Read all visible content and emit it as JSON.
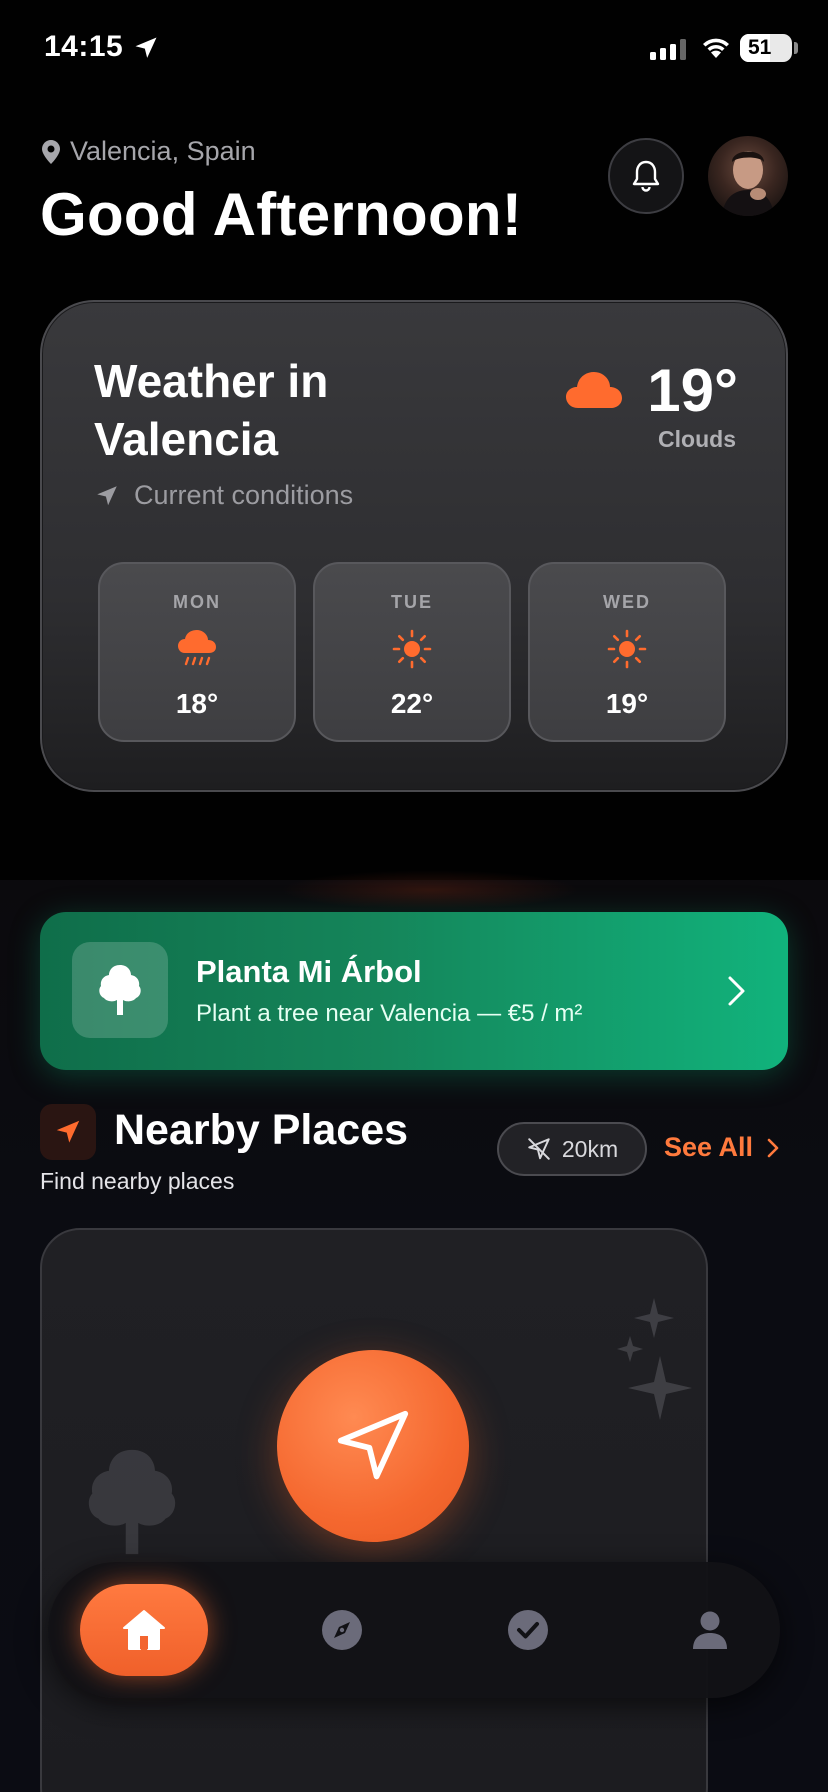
{
  "status_bar": {
    "time": "14:15",
    "battery": "51"
  },
  "header": {
    "location": "Valencia, Spain",
    "greeting": "Good Afternoon!"
  },
  "weather": {
    "title": "Weather in Valencia",
    "subtitle": "Current conditions",
    "temperature": "19°",
    "condition": "Clouds",
    "forecast": [
      {
        "day": "MON",
        "icon": "rain-cloud-icon",
        "temp": "18°"
      },
      {
        "day": "TUE",
        "icon": "sun-icon",
        "temp": "22°"
      },
      {
        "day": "WED",
        "icon": "sun-icon",
        "temp": "19°"
      }
    ]
  },
  "promo": {
    "title": "Planta Mi Árbol",
    "subtitle": "Plant a tree near Valencia — €5 / m²"
  },
  "nearby": {
    "title": "Nearby Places",
    "subtitle": "Find nearby places",
    "radius": "20km",
    "see_all": "See All"
  },
  "tabbar": {
    "items": [
      "home-icon",
      "compass-icon",
      "check-icon",
      "profile-icon"
    ],
    "active": "home-icon"
  },
  "colors": {
    "accent": "#ff6b2e",
    "promo_green": "#12a06c",
    "background": "#000000"
  }
}
